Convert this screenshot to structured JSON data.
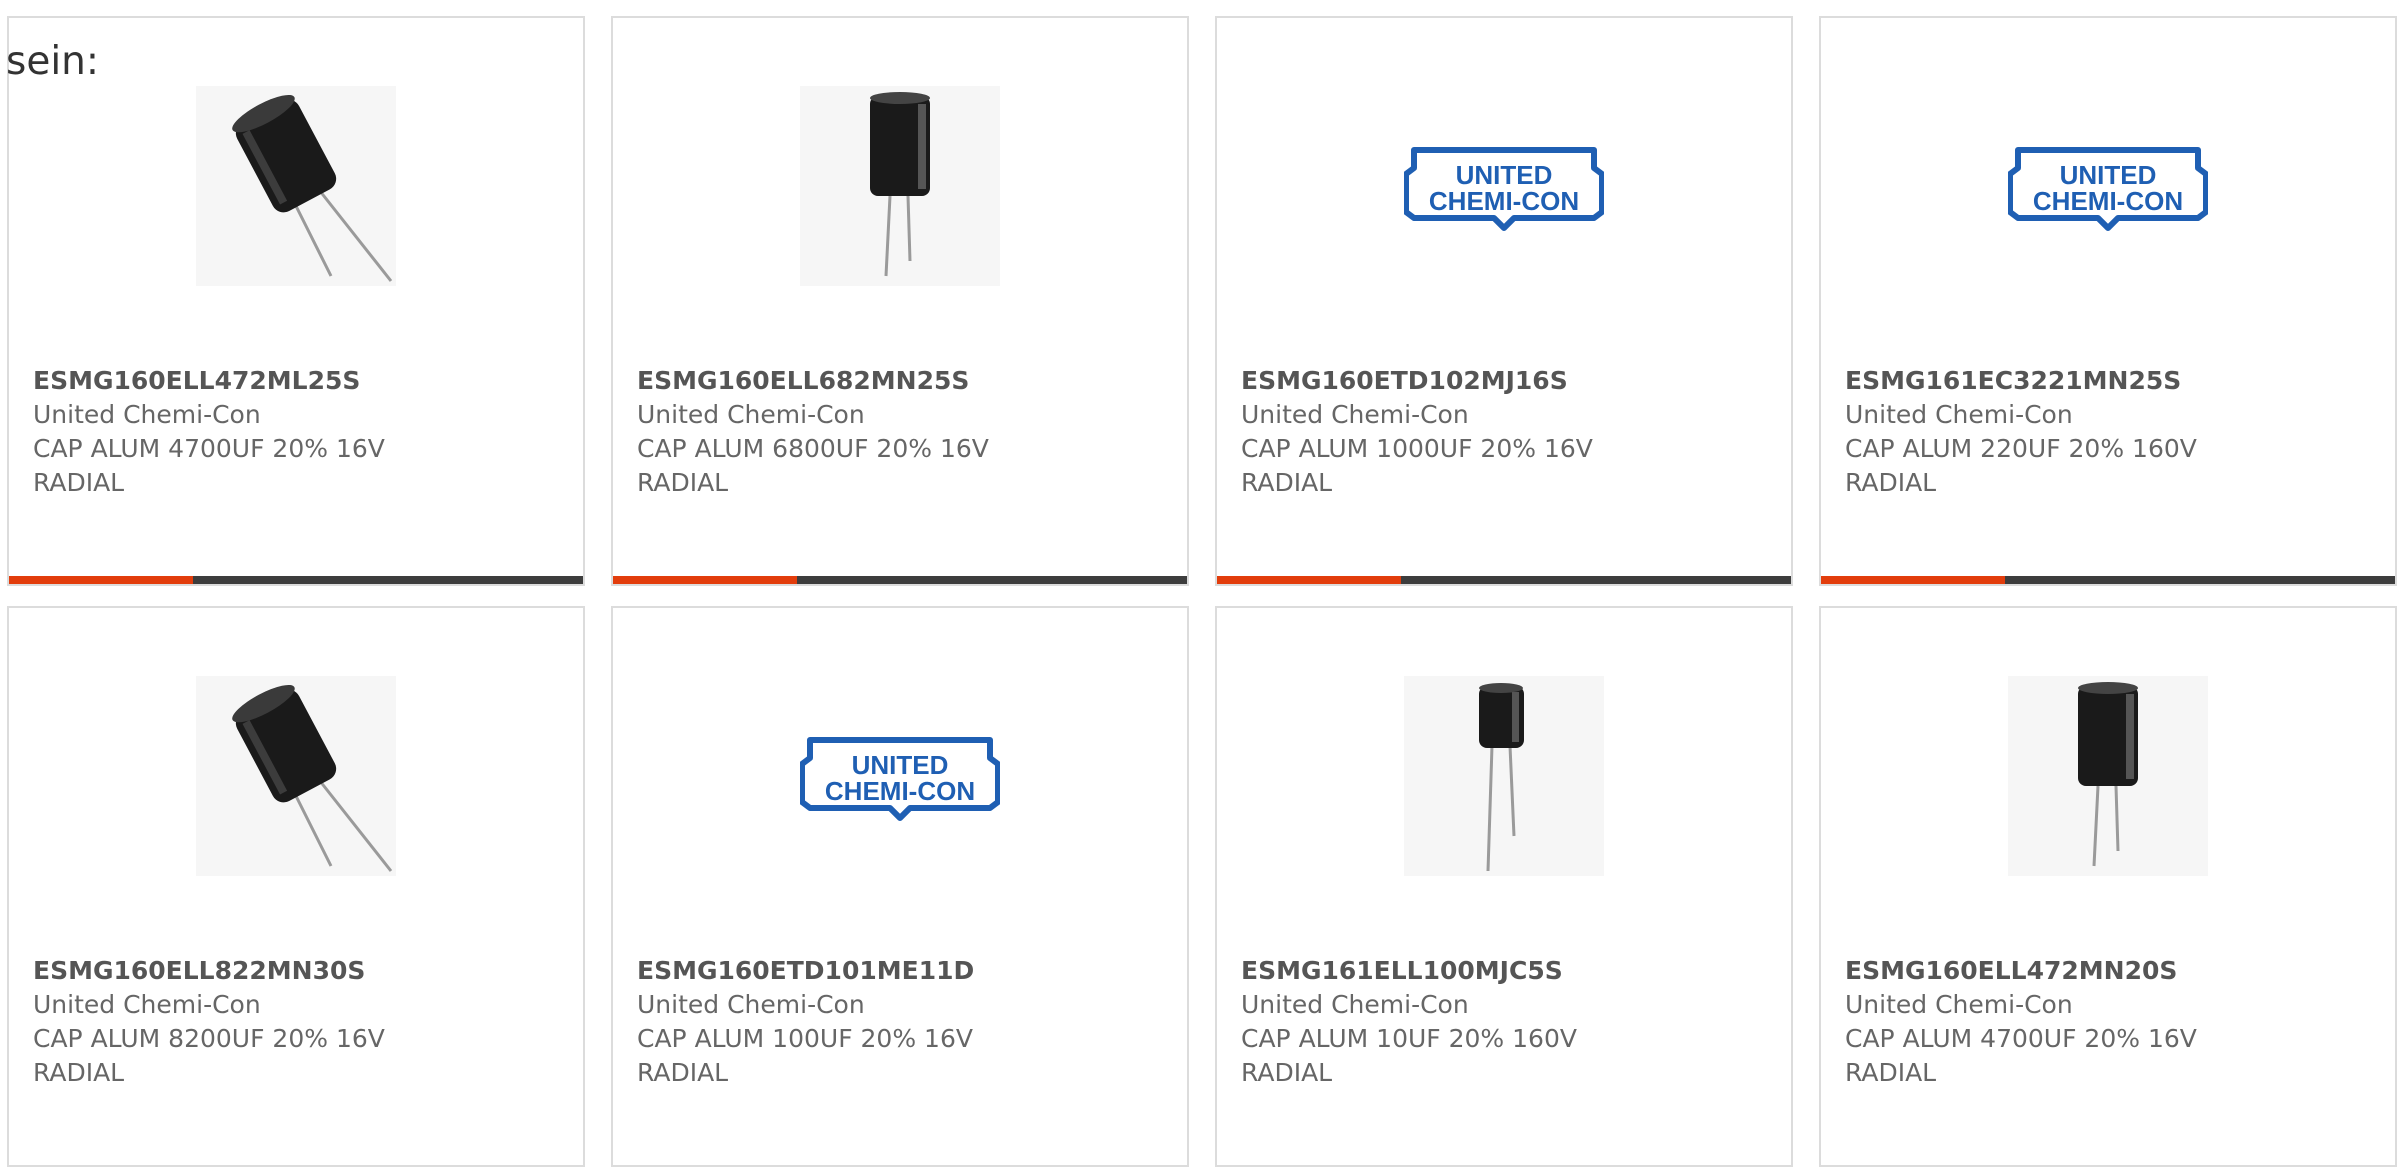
{
  "lead_text": "sein:",
  "colors": {
    "accent": "#e23d0c",
    "bar": "#3d3d3d",
    "border": "#dcdcdc",
    "logo_blue": "#1f5fb3"
  },
  "logo_text": {
    "line1": "UNITED",
    "line2": "CHEMI-CON"
  },
  "products": [
    {
      "part": "ESMG160ELL472ML25S",
      "manufacturer": "United Chemi-Con",
      "description": "CAP ALUM 4700UF 20% 16V\nRADIAL",
      "image": "capacitor-tilted",
      "progress": 0.32
    },
    {
      "part": "ESMG160ELL682MN25S",
      "manufacturer": "United Chemi-Con",
      "description": "CAP ALUM 6800UF 20% 16V\nRADIAL",
      "image": "capacitor-upright",
      "progress": 0.32
    },
    {
      "part": "ESMG160ETD102MJ16S",
      "manufacturer": "United Chemi-Con",
      "description": "CAP ALUM 1000UF 20% 16V\nRADIAL",
      "image": "united-chemi-con-logo",
      "progress": 0.32
    },
    {
      "part": "ESMG161EC3221MN25S",
      "manufacturer": "United Chemi-Con",
      "description": "CAP ALUM 220UF 20% 160V\nRADIAL",
      "image": "united-chemi-con-logo",
      "progress": 0.32
    },
    {
      "part": "ESMG160ELL822MN30S",
      "manufacturer": "United Chemi-Con",
      "description": "CAP ALUM 8200UF 20% 16V\nRADIAL",
      "image": "capacitor-tilted",
      "progress": 0
    },
    {
      "part": "ESMG160ETD101ME11D",
      "manufacturer": "United Chemi-Con",
      "description": "CAP ALUM 100UF 20% 16V\nRADIAL",
      "image": "united-chemi-con-logo",
      "progress": 0
    },
    {
      "part": "ESMG161ELL100MJC5S",
      "manufacturer": "United Chemi-Con",
      "description": "CAP ALUM 10UF 20% 160V\nRADIAL",
      "image": "capacitor-small",
      "progress": 0
    },
    {
      "part": "ESMG160ELL472MN20S",
      "manufacturer": "United Chemi-Con",
      "description": "CAP ALUM 4700UF 20% 16V\nRADIAL",
      "image": "capacitor-upright",
      "progress": 0
    }
  ]
}
